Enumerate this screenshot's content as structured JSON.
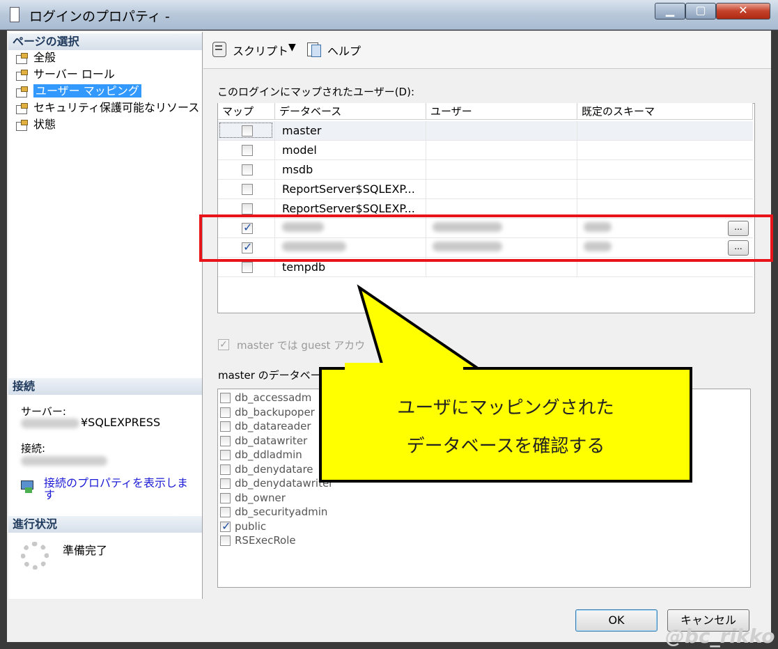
{
  "window": {
    "title": "ログインのプロパティ -"
  },
  "left": {
    "page_select_header": "ページの選択",
    "pages": [
      "全般",
      "サーバー ロール",
      "ユーザー マッピング",
      "セキュリティ保護可能なリソース",
      "状態"
    ],
    "connection_header": "接続",
    "server_label": "サーバー:",
    "server_value": "¥SQLEXPRESS",
    "conn_label": "接続:",
    "conn_props_link": "接続のプロパティを表示します",
    "progress_header": "進行状況",
    "progress_status": "準備完了"
  },
  "toolbar": {
    "script_label": "スクリプト",
    "help_label": "ヘルプ"
  },
  "mapping": {
    "label": "このログインにマップされたユーザー(D):",
    "columns": [
      "マップ",
      "データベース",
      "ユーザー",
      "既定のスキーマ"
    ],
    "rows": [
      {
        "db": "master",
        "checked": false
      },
      {
        "db": "model",
        "checked": false
      },
      {
        "db": "msdb",
        "checked": false
      },
      {
        "db": "ReportServer$SQLEXP...",
        "checked": false
      },
      {
        "db": "ReportServer$SQLEXP...",
        "checked": false
      },
      {
        "db": "",
        "checked": true
      },
      {
        "db": "",
        "checked": true
      },
      {
        "db": "tempdb",
        "checked": false
      }
    ],
    "ellipsis": "..."
  },
  "guest_label": "master では guest アカウ",
  "roles_label": "master のデータベー",
  "roles": [
    {
      "name": "db_accessadm",
      "checked": false
    },
    {
      "name": "db_backupoper",
      "checked": false
    },
    {
      "name": "db_datareader",
      "checked": false
    },
    {
      "name": "db_datawriter",
      "checked": false
    },
    {
      "name": "db_ddladmin",
      "checked": false
    },
    {
      "name": "db_denydatare",
      "checked": false
    },
    {
      "name": "db_denydatawriter",
      "checked": false
    },
    {
      "name": "db_owner",
      "checked": false
    },
    {
      "name": "db_securityadmin",
      "checked": false
    },
    {
      "name": "public",
      "checked": true
    },
    {
      "name": "RSExecRole",
      "checked": false
    }
  ],
  "callout": {
    "line1": "ユーザにマッピングされた",
    "line2": "データベースを確認する"
  },
  "buttons": {
    "ok": "OK",
    "cancel": "キャンセル"
  },
  "watermark": "@bc_rikko"
}
